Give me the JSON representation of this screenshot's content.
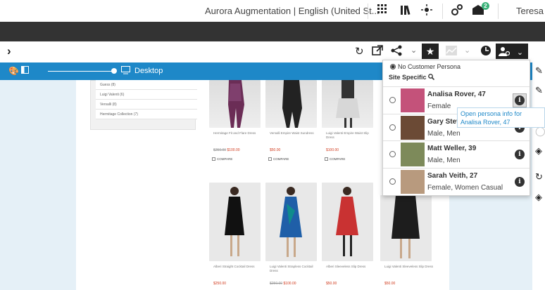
{
  "topbar": {
    "site_selector": "Aurora Augmentation | English (United St...",
    "notification_count": "2",
    "user": "Teresa"
  },
  "toolbar": {
    "collapse_icon": "chevron-right-icon"
  },
  "device": {
    "label": "Desktop"
  },
  "facets": [
    "Guess (8)",
    "Luigi Valenti (6)",
    "Versalli (8)",
    "Hermitage Collection (7)"
  ],
  "products": {
    "row1": [
      {
        "name": "Hermitage Fit and Flare Dress",
        "old_price": "$250.00",
        "price": "$100.00"
      },
      {
        "name": "Versalli Empire Waist Sundress",
        "old_price": "",
        "price": "$50.00"
      },
      {
        "name": "Luigi Valenti Empire Waist Slip Dress",
        "old_price": "",
        "price": "$100.00"
      }
    ],
    "compare_label": "COMPARE",
    "row2": [
      {
        "name": "Alberi Straight Cocktail Dress",
        "old_price": "",
        "price": "$250.00"
      },
      {
        "name": "Luigi Valenti Strapless Cocktail Dress",
        "old_price": "$250.00",
        "price": "$100.00"
      },
      {
        "name": "Alberi Sleeveless Slip Dress",
        "old_price": "",
        "price": "$50.00"
      },
      {
        "name": "Luigi Valenti Sleeveless Slip Dress",
        "old_price": "",
        "price": "$50.00"
      }
    ]
  },
  "persona": {
    "none_label": "No Customer Persona",
    "site_specific_label": "Site Specific",
    "items": [
      {
        "name": "Analisa Rover, 47",
        "segment": "Female",
        "photo_color": "#c4527a"
      },
      {
        "name": "Gary Steve",
        "segment": "Male, Men",
        "photo_color": "#6b4a35"
      },
      {
        "name": "Matt Weller, 39",
        "segment": "Male, Men",
        "photo_color": "#7d8a5a"
      },
      {
        "name": "Sarah Veith, 27",
        "segment": "Female, Women Casual",
        "photo_color": "#b89a7e"
      }
    ],
    "tooltip": "Open persona info for Analisa Rover, 47"
  },
  "colors": {
    "accent": "#1e88c8",
    "dark_bar": "#333333",
    "preview_bg": "#e5f0f7"
  }
}
